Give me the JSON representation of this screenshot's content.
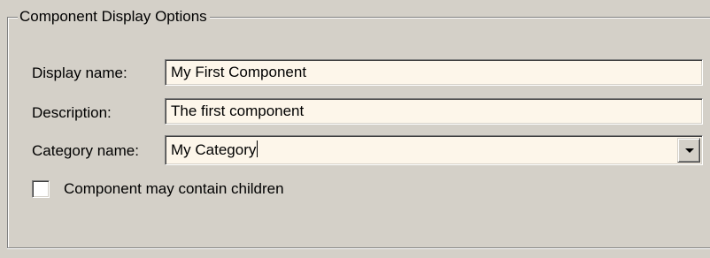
{
  "group": {
    "title": "Component Display Options"
  },
  "form": {
    "display_name": {
      "label": "Display name:",
      "value": "My First Component"
    },
    "description": {
      "label": "Description:",
      "value": "The first component"
    },
    "category_name": {
      "label": "Category name:",
      "value": "My Category",
      "dropdown_icon": "chevron-down-icon"
    },
    "may_contain_children": {
      "label": "Component may contain children",
      "checked": false
    }
  },
  "colors": {
    "dialog_background": "#d4d0c8",
    "field_background": "#fdf6ea"
  }
}
